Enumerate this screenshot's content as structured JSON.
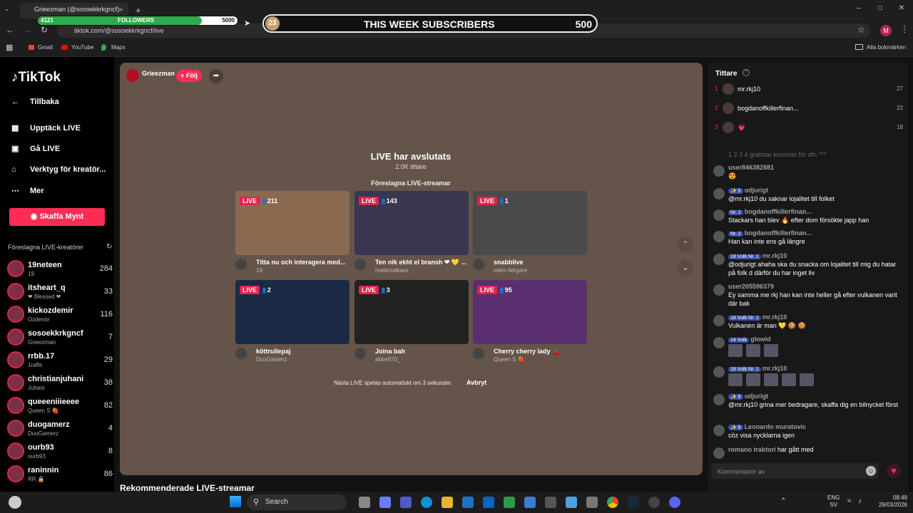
{
  "browser": {
    "tab_title": "Grieezman (@sosoekkrkgncf) ·",
    "url": "tiktok.com/@sosoekkrkgncf/live",
    "bookmarks": [
      "Gmail",
      "YouTube",
      "Maps"
    ],
    "all_bookmarks": "Alla bokmärken",
    "profile_initial": "M"
  },
  "overlay": {
    "followers_current": "4121",
    "followers_label": "FOLLOWERS",
    "followers_goal": "5000",
    "followers_progress": 0.82,
    "subs_count": "23",
    "subs_label": "THIS WEEK SUBSCRIBERS",
    "subs_goal": "500"
  },
  "sidebar": {
    "logo": "TikTok",
    "back": "Tillbaka",
    "discover": "Upptäck LIVE",
    "go_live": "Gå LIVE",
    "tools": "Verktyg för kreatör...",
    "more": "Mer",
    "coins_button": "Skaffa Mynt",
    "suggested_header": "Föreslagna LIVE-kreatörer",
    "creators": [
      {
        "name": "19neteen",
        "sub": "19",
        "count": "284"
      },
      {
        "name": "itsheart_q",
        "sub": "❤ Blessed ❤",
        "count": "33"
      },
      {
        "name": "kickozdemir",
        "sub": "Ozdemir",
        "count": "116"
      },
      {
        "name": "sosoekkrkgncf",
        "sub": "Grieezman",
        "count": "7"
      },
      {
        "name": "rrbb.17",
        "sub": "1raffe",
        "count": "29"
      },
      {
        "name": "christianjuhani",
        "sub": "Juhani",
        "count": "38"
      },
      {
        "name": "queeeniiieeee",
        "sub": "Queen S 🍓",
        "count": "82"
      },
      {
        "name": "duogamerz",
        "sub": "DuoGamerz",
        "count": "4"
      },
      {
        "name": "ourb93",
        "sub": "ourb93",
        "count": "8"
      },
      {
        "name": "raninnin",
        "sub": "RR 🔒",
        "count": "86"
      }
    ]
  },
  "player": {
    "host_name": "Grieezman",
    "follow_label": "+ Följ",
    "ended_title": "LIVE har avslutats",
    "ended_viewers": "2.0K tittare",
    "suggested_title": "Föreslagna LIVE-streamar",
    "live_label": "LIVE",
    "autoplay_text": "Nästa LIVE spelas automatiskt om 3 sekunder.",
    "cancel_label": "Avbryt",
    "recommended_heading": "Rekommenderade LIVE-streamar",
    "cards": [
      {
        "viewers": "211",
        "title": "Titta nu och interagera med...",
        "user": "19",
        "color": "#8a6a50"
      },
      {
        "viewers": "143",
        "title": "Ten nik ekht el bransh ❤ 💛 ...",
        "user": "mattezalkass",
        "color": "#3a3550"
      },
      {
        "viewers": "1",
        "title": "snabblive",
        "user": "oden-bilrgare",
        "color": "#4a4a4a"
      },
      {
        "viewers": "2",
        "title": "köttrullepaj",
        "user": "DuoGamerz",
        "color": "#1a2a44"
      },
      {
        "viewers": "3",
        "title": "Joina bah",
        "user": "abbe870_",
        "color": "#222222"
      },
      {
        "viewers": "95",
        "title": "Cherry cherry lady 🍒",
        "user": "Queen S 🍓",
        "color": "#5a2f70"
      }
    ]
  },
  "chat": {
    "viewers_header": "Tittare",
    "top_viewers": [
      {
        "rank": "1",
        "name": "mr.rkj10",
        "score": "27"
      },
      {
        "rank": "2",
        "name": "bogdanoffkillerfinan...",
        "score": "22"
      },
      {
        "rank": "3",
        "name": "💗",
        "score": "18"
      }
    ],
    "faded_line": "1 2 3 4 grabbar kommer för dfn ***",
    "messages": [
      {
        "user": "user846382881",
        "text": "😍",
        "badges": ""
      },
      {
        "user": "odjurigt",
        "text": "@mr.rkj10 du saknar lojalitet till folket",
        "badges": "✨ 9"
      },
      {
        "user": "bogdanoffkillerfinan...",
        "text": "Stackars han blev 🔥 efter dom försökte japp han",
        "badges": "Nr. 2"
      },
      {
        "user": "bogdanoffkillerfinan...",
        "text": "Han kan inte ens gå längre",
        "badges": "Nr. 2"
      },
      {
        "user": "mr.rkj10",
        "text": "@odjurigt ahaha ska du snacka om lojalitet till mig du hatar på folk d därför du har inget liv",
        "badges": "18 Vulk Nr. 1"
      },
      {
        "user": "user205596379",
        "text": "Ey samma me rkj han kan inte heller gå efter vulkanen varit där bak",
        "badges": ""
      },
      {
        "user": "mr.rkj10",
        "text": "Vulkanen är man 💛 🍪 🍪",
        "badges": "18 Vulk Nr. 1"
      },
      {
        "user": "glowid",
        "text": "",
        "badges": "14 Vulk"
      },
      {
        "user": "mr.rkj10",
        "text": "",
        "badges": "18 Vulk Nr. 1"
      },
      {
        "user": "odjurigt",
        "text": "@mr.rkj10 grina mer bedragare, skaffa dig en bilnyckel först",
        "badges": "✨ 9"
      },
      {
        "user": "Leonardo muratovic",
        "text": "cöz visa nycklarna igen",
        "badges": "✨ 9"
      },
      {
        "user": "romano traktori",
        "text": "har gått med",
        "badges": ""
      }
    ],
    "comment_placeholder": "Kommentarer av"
  },
  "taskbar": {
    "search": "Search",
    "lang": "ENG",
    "lang2": "SV",
    "time": "08:49",
    "date": "29/03/2026"
  }
}
